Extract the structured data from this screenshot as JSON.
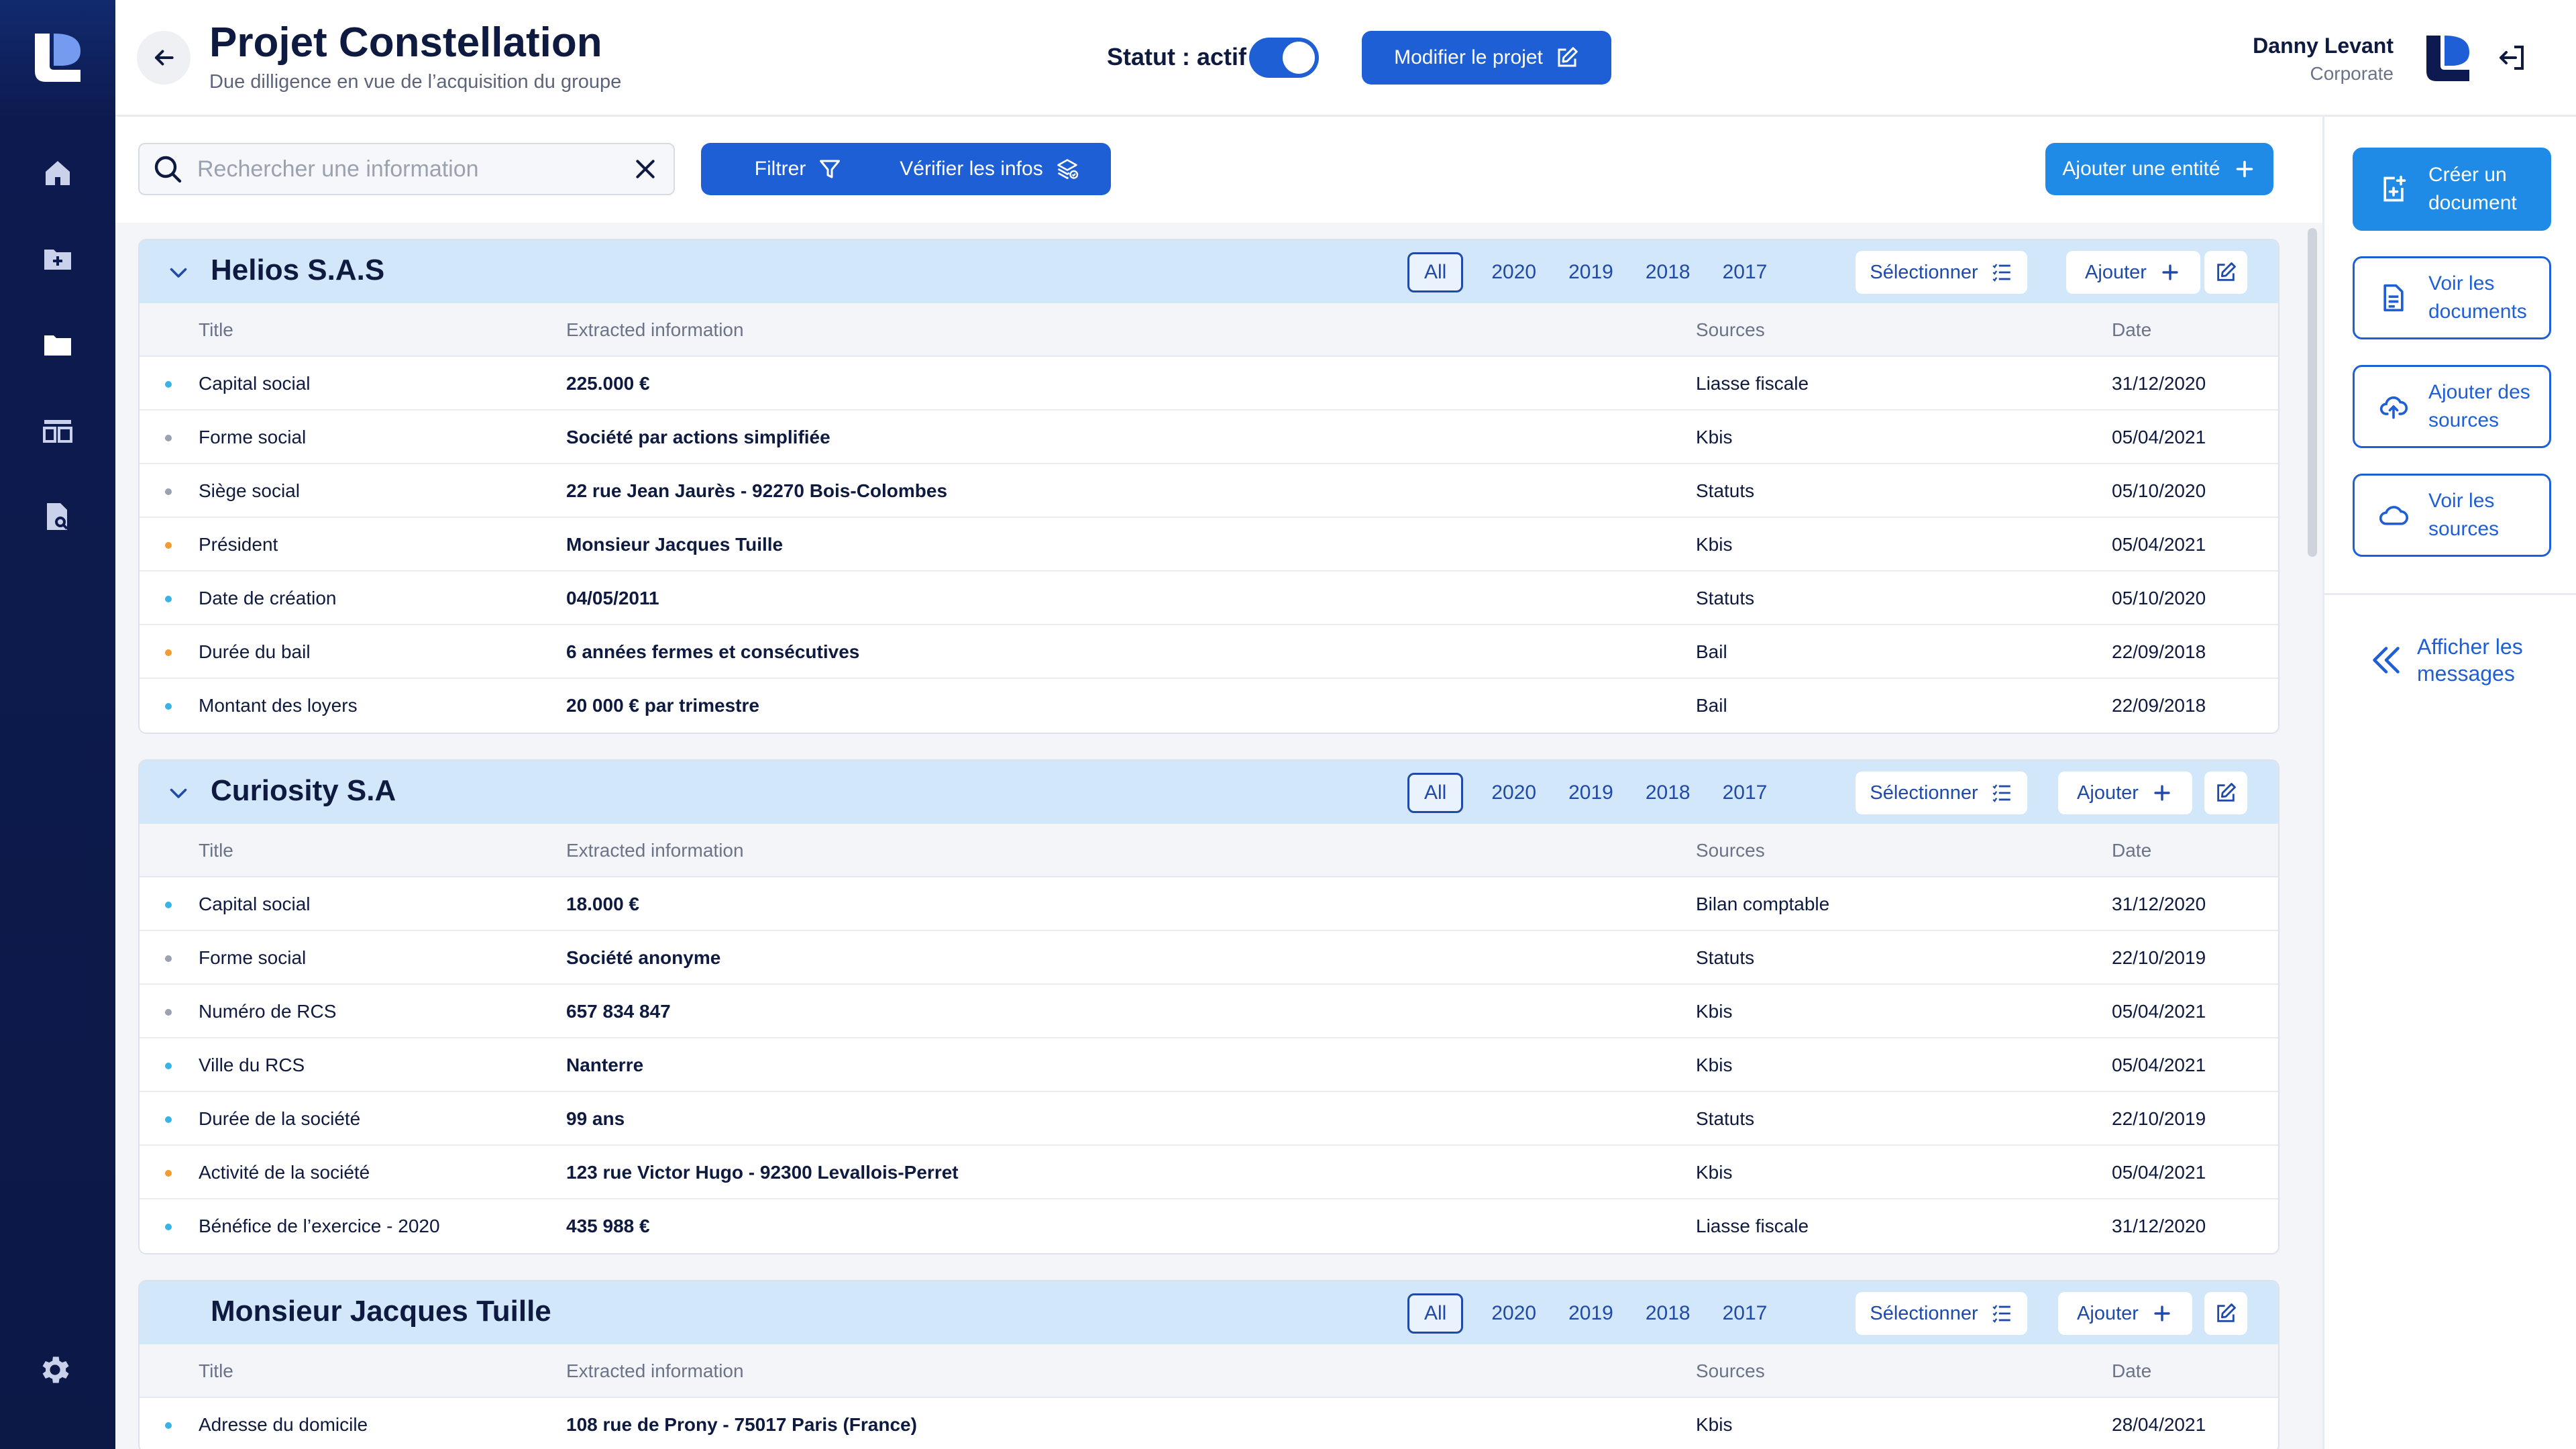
{
  "app": {
    "title": "Projet Constellation",
    "subtitle": "Due dilligence en vue de l’acquisition du groupe",
    "status_label": "Statut : actif",
    "status_active": true,
    "edit_project_label": "Modifier le projet"
  },
  "user": {
    "name": "Danny Levant",
    "role": "Corporate"
  },
  "toolbar": {
    "search_placeholder": "Rechercher une information",
    "search_value": "",
    "filter_label": "Filtrer",
    "verify_label": "Vérifier les infos",
    "add_entity_label": "Ajouter une entité"
  },
  "colors": {
    "primary": "#1f5fd6",
    "accent": "#1f8be6",
    "sidebar": "#0d1a4f",
    "entity_header": "#d3e7fb",
    "dot_blue": "#3bb3e6",
    "dot_gray": "#9aa1b0",
    "dot_orange": "#f29b2e"
  },
  "sidebar_icons": [
    "home-icon",
    "folder-add-icon",
    "folder-icon",
    "layout-icon",
    "document-search-icon",
    "settings-icon"
  ],
  "table_headers": {
    "title": "Title",
    "info": "Extracted information",
    "sources": "Sources",
    "date": "Date"
  },
  "entity_controls": {
    "years": [
      "All",
      "2020",
      "2019",
      "2018",
      "2017"
    ],
    "select_label": "Sélectionner",
    "add_label": "Ajouter"
  },
  "entities": [
    {
      "name": "Helios S.A.S",
      "collapsible": true,
      "rows": [
        {
          "dot": "blue",
          "title": "Capital social",
          "info": "225.000 €",
          "source": "Liasse fiscale",
          "date": "31/12/2020"
        },
        {
          "dot": "gray",
          "title": "Forme social",
          "info": "Société par actions simplifiée",
          "source": "Kbis",
          "date": "05/04/2021"
        },
        {
          "dot": "gray",
          "title": "Siège social",
          "info": "22 rue Jean Jaurès - 92270 Bois-Colombes",
          "source": "Statuts",
          "date": "05/10/2020"
        },
        {
          "dot": "orange",
          "title": "Président",
          "info": "Monsieur Jacques Tuille",
          "source": "Kbis",
          "date": "05/04/2021"
        },
        {
          "dot": "blue",
          "title": "Date de création",
          "info": "04/05/2011",
          "source": "Statuts",
          "date": "05/10/2020"
        },
        {
          "dot": "orange",
          "title": "Durée du bail",
          "info": "6 années fermes et consécutives",
          "source": "Bail",
          "date": "22/09/2018"
        },
        {
          "dot": "blue",
          "title": "Montant des loyers",
          "info": "20 000 € par trimestre",
          "source": "Bail",
          "date": "22/09/2018"
        }
      ]
    },
    {
      "name": "Curiosity S.A",
      "collapsible": true,
      "rows": [
        {
          "dot": "blue",
          "title": "Capital social",
          "info": "18.000 €",
          "source": "Bilan comptable",
          "date": "31/12/2020"
        },
        {
          "dot": "gray",
          "title": "Forme social",
          "info": "Société anonyme",
          "source": "Statuts",
          "date": "22/10/2019"
        },
        {
          "dot": "gray",
          "title": "Numéro de RCS",
          "info": "657 834 847",
          "source": "Kbis",
          "date": "05/04/2021"
        },
        {
          "dot": "blue",
          "title": "Ville du RCS",
          "info": "Nanterre",
          "source": "Kbis",
          "date": "05/04/2021"
        },
        {
          "dot": "blue",
          "title": "Durée de la société",
          "info": "99 ans",
          "source": "Statuts",
          "date": "22/10/2019"
        },
        {
          "dot": "orange",
          "title": "Activité de la société",
          "info": "123 rue Victor Hugo - 92300 Levallois-Perret",
          "source": "Kbis",
          "date": "05/04/2021"
        },
        {
          "dot": "blue",
          "title": "Bénéfice de l’exercice - 2020",
          "info": "435 988 €",
          "source": "Liasse fiscale",
          "date": "31/12/2020"
        }
      ]
    },
    {
      "name": "Monsieur Jacques Tuille",
      "collapsible": false,
      "rows": [
        {
          "dot": "blue",
          "title": "Adresse du domicile",
          "info": "108 rue de Prony - 75017 Paris (France)",
          "source": "Kbis",
          "date": "28/04/2021"
        }
      ]
    }
  ],
  "right_panel": {
    "actions": [
      {
        "label": "Créer un document",
        "icon": "document-add-icon",
        "filled": true
      },
      {
        "label": "Voir les documents",
        "icon": "document-icon",
        "filled": false
      },
      {
        "label": "Ajouter des sources",
        "icon": "cloud-upload-icon",
        "filled": false
      },
      {
        "label": "Voir les sources",
        "icon": "cloud-icon",
        "filled": false
      }
    ],
    "messages_label": "Afficher les messages"
  }
}
